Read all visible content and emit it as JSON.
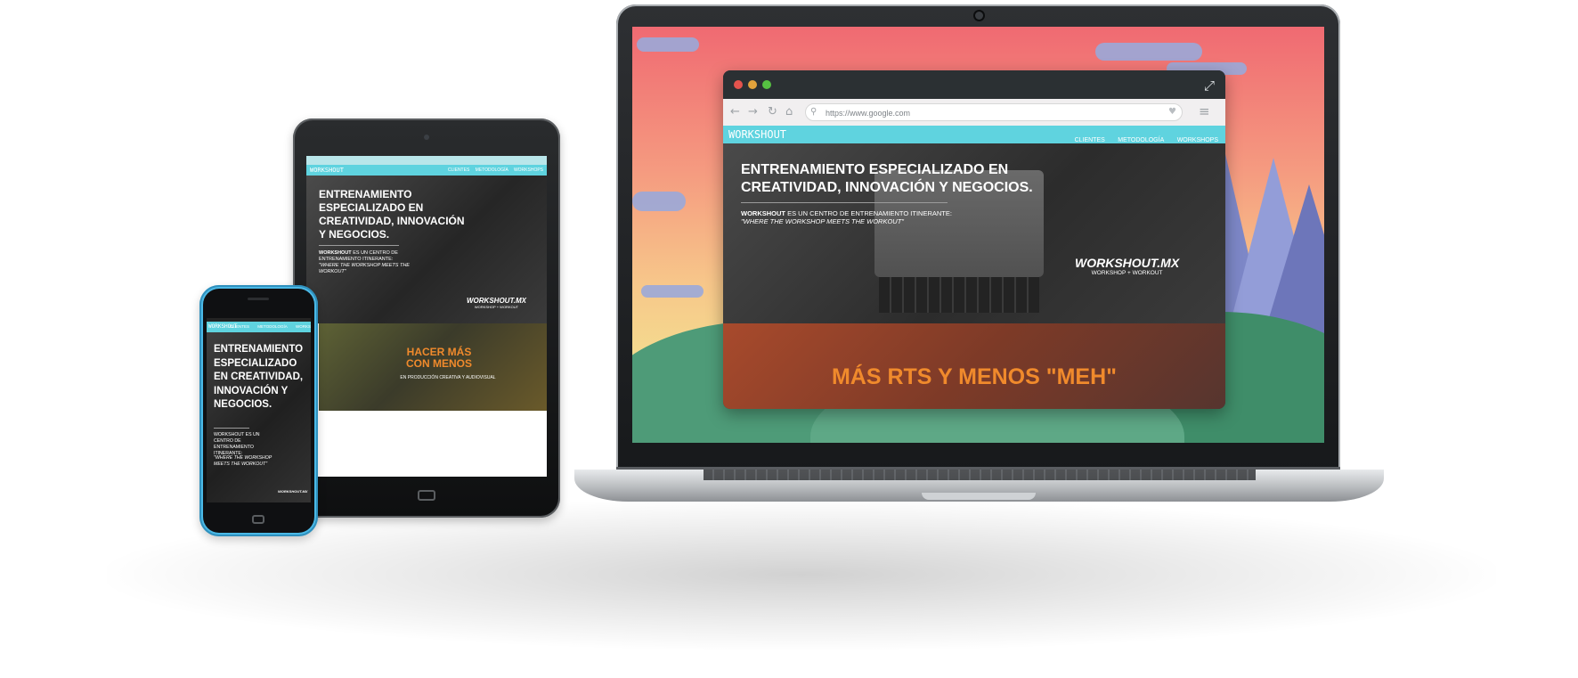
{
  "browser": {
    "url": "https://www.google.com",
    "traffic_lights": {
      "close": "#e4534d",
      "minimize": "#e2a23b",
      "maximize": "#56c142"
    }
  },
  "site": {
    "logo": "WORKSHOUT",
    "nav": [
      "CLIENTES",
      "METODOLOGÍA",
      "WORKSHOPS"
    ],
    "hero": {
      "title": "ENTRENAMIENTO ESPECIALIZADO EN CREATIVIDAD, INNOVACIÓN Y NEGOCIOS.",
      "brand_word": "WORKSHOUT",
      "description_rest": " ES UN CENTRO DE ENTRENAMIENTO ITINERANTE:",
      "quote": "\"WHERE THE WORKSHOP MEETS THE WORKOUT\"",
      "brand_name": "WORKSHOUT.MX",
      "brand_tagline": "WORKSHOP + WORKOUT"
    },
    "section2_laptop": "MÁS RTS Y MENOS \"MEH\"",
    "section2_tablet": {
      "title": "HACER MÁS CON MENOS",
      "subtitle": "EN PRODUCCIÓN CREATIVA Y AUDIOVISUAL"
    }
  },
  "phone": {
    "title": "ENTRENAMIENTO ESPECIALIZADO EN CREATIVIDAD, INNOVACIÓN Y NEGOCIOS.",
    "description": "WORKSHOUT ES UN CENTRO DE ENTRENAMIENTO ITINERANTE:",
    "quote": "\"WHERE THE WORKSHOP MEETS THE WORKOUT\""
  },
  "colors": {
    "nav": "#5fd3df",
    "accent_orange": "#f08a2c",
    "phone_body": "#4bb9e6"
  },
  "icons": [
    "back-arrow-icon",
    "forward-arrow-icon",
    "reload-icon",
    "home-icon",
    "search-icon",
    "heart-icon",
    "menu-icon",
    "expand-icon"
  ]
}
